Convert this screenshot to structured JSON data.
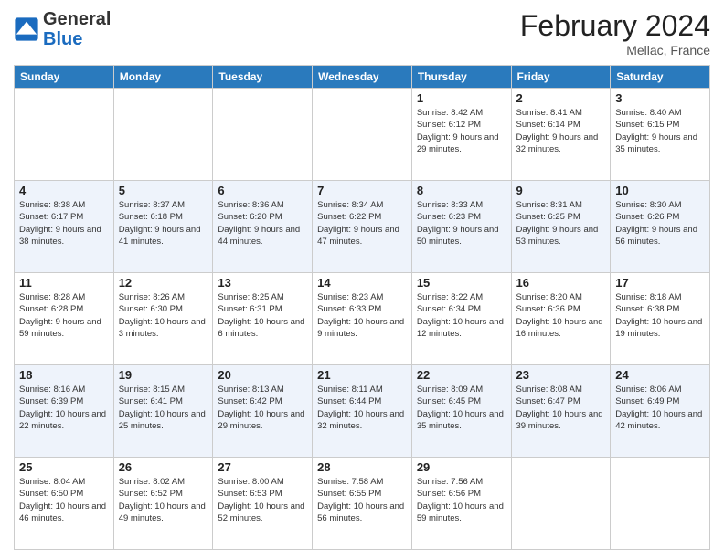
{
  "header": {
    "logo_line1": "General",
    "logo_line2": "Blue",
    "month_year": "February 2024",
    "location": "Mellac, France"
  },
  "days_of_week": [
    "Sunday",
    "Monday",
    "Tuesday",
    "Wednesday",
    "Thursday",
    "Friday",
    "Saturday"
  ],
  "weeks": [
    [
      {
        "day": "",
        "info": ""
      },
      {
        "day": "",
        "info": ""
      },
      {
        "day": "",
        "info": ""
      },
      {
        "day": "",
        "info": ""
      },
      {
        "day": "1",
        "info": "Sunrise: 8:42 AM\nSunset: 6:12 PM\nDaylight: 9 hours and 29 minutes."
      },
      {
        "day": "2",
        "info": "Sunrise: 8:41 AM\nSunset: 6:14 PM\nDaylight: 9 hours and 32 minutes."
      },
      {
        "day": "3",
        "info": "Sunrise: 8:40 AM\nSunset: 6:15 PM\nDaylight: 9 hours and 35 minutes."
      }
    ],
    [
      {
        "day": "4",
        "info": "Sunrise: 8:38 AM\nSunset: 6:17 PM\nDaylight: 9 hours and 38 minutes."
      },
      {
        "day": "5",
        "info": "Sunrise: 8:37 AM\nSunset: 6:18 PM\nDaylight: 9 hours and 41 minutes."
      },
      {
        "day": "6",
        "info": "Sunrise: 8:36 AM\nSunset: 6:20 PM\nDaylight: 9 hours and 44 minutes."
      },
      {
        "day": "7",
        "info": "Sunrise: 8:34 AM\nSunset: 6:22 PM\nDaylight: 9 hours and 47 minutes."
      },
      {
        "day": "8",
        "info": "Sunrise: 8:33 AM\nSunset: 6:23 PM\nDaylight: 9 hours and 50 minutes."
      },
      {
        "day": "9",
        "info": "Sunrise: 8:31 AM\nSunset: 6:25 PM\nDaylight: 9 hours and 53 minutes."
      },
      {
        "day": "10",
        "info": "Sunrise: 8:30 AM\nSunset: 6:26 PM\nDaylight: 9 hours and 56 minutes."
      }
    ],
    [
      {
        "day": "11",
        "info": "Sunrise: 8:28 AM\nSunset: 6:28 PM\nDaylight: 9 hours and 59 minutes."
      },
      {
        "day": "12",
        "info": "Sunrise: 8:26 AM\nSunset: 6:30 PM\nDaylight: 10 hours and 3 minutes."
      },
      {
        "day": "13",
        "info": "Sunrise: 8:25 AM\nSunset: 6:31 PM\nDaylight: 10 hours and 6 minutes."
      },
      {
        "day": "14",
        "info": "Sunrise: 8:23 AM\nSunset: 6:33 PM\nDaylight: 10 hours and 9 minutes."
      },
      {
        "day": "15",
        "info": "Sunrise: 8:22 AM\nSunset: 6:34 PM\nDaylight: 10 hours and 12 minutes."
      },
      {
        "day": "16",
        "info": "Sunrise: 8:20 AM\nSunset: 6:36 PM\nDaylight: 10 hours and 16 minutes."
      },
      {
        "day": "17",
        "info": "Sunrise: 8:18 AM\nSunset: 6:38 PM\nDaylight: 10 hours and 19 minutes."
      }
    ],
    [
      {
        "day": "18",
        "info": "Sunrise: 8:16 AM\nSunset: 6:39 PM\nDaylight: 10 hours and 22 minutes."
      },
      {
        "day": "19",
        "info": "Sunrise: 8:15 AM\nSunset: 6:41 PM\nDaylight: 10 hours and 25 minutes."
      },
      {
        "day": "20",
        "info": "Sunrise: 8:13 AM\nSunset: 6:42 PM\nDaylight: 10 hours and 29 minutes."
      },
      {
        "day": "21",
        "info": "Sunrise: 8:11 AM\nSunset: 6:44 PM\nDaylight: 10 hours and 32 minutes."
      },
      {
        "day": "22",
        "info": "Sunrise: 8:09 AM\nSunset: 6:45 PM\nDaylight: 10 hours and 35 minutes."
      },
      {
        "day": "23",
        "info": "Sunrise: 8:08 AM\nSunset: 6:47 PM\nDaylight: 10 hours and 39 minutes."
      },
      {
        "day": "24",
        "info": "Sunrise: 8:06 AM\nSunset: 6:49 PM\nDaylight: 10 hours and 42 minutes."
      }
    ],
    [
      {
        "day": "25",
        "info": "Sunrise: 8:04 AM\nSunset: 6:50 PM\nDaylight: 10 hours and 46 minutes."
      },
      {
        "day": "26",
        "info": "Sunrise: 8:02 AM\nSunset: 6:52 PM\nDaylight: 10 hours and 49 minutes."
      },
      {
        "day": "27",
        "info": "Sunrise: 8:00 AM\nSunset: 6:53 PM\nDaylight: 10 hours and 52 minutes."
      },
      {
        "day": "28",
        "info": "Sunrise: 7:58 AM\nSunset: 6:55 PM\nDaylight: 10 hours and 56 minutes."
      },
      {
        "day": "29",
        "info": "Sunrise: 7:56 AM\nSunset: 6:56 PM\nDaylight: 10 hours and 59 minutes."
      },
      {
        "day": "",
        "info": ""
      },
      {
        "day": "",
        "info": ""
      }
    ]
  ]
}
